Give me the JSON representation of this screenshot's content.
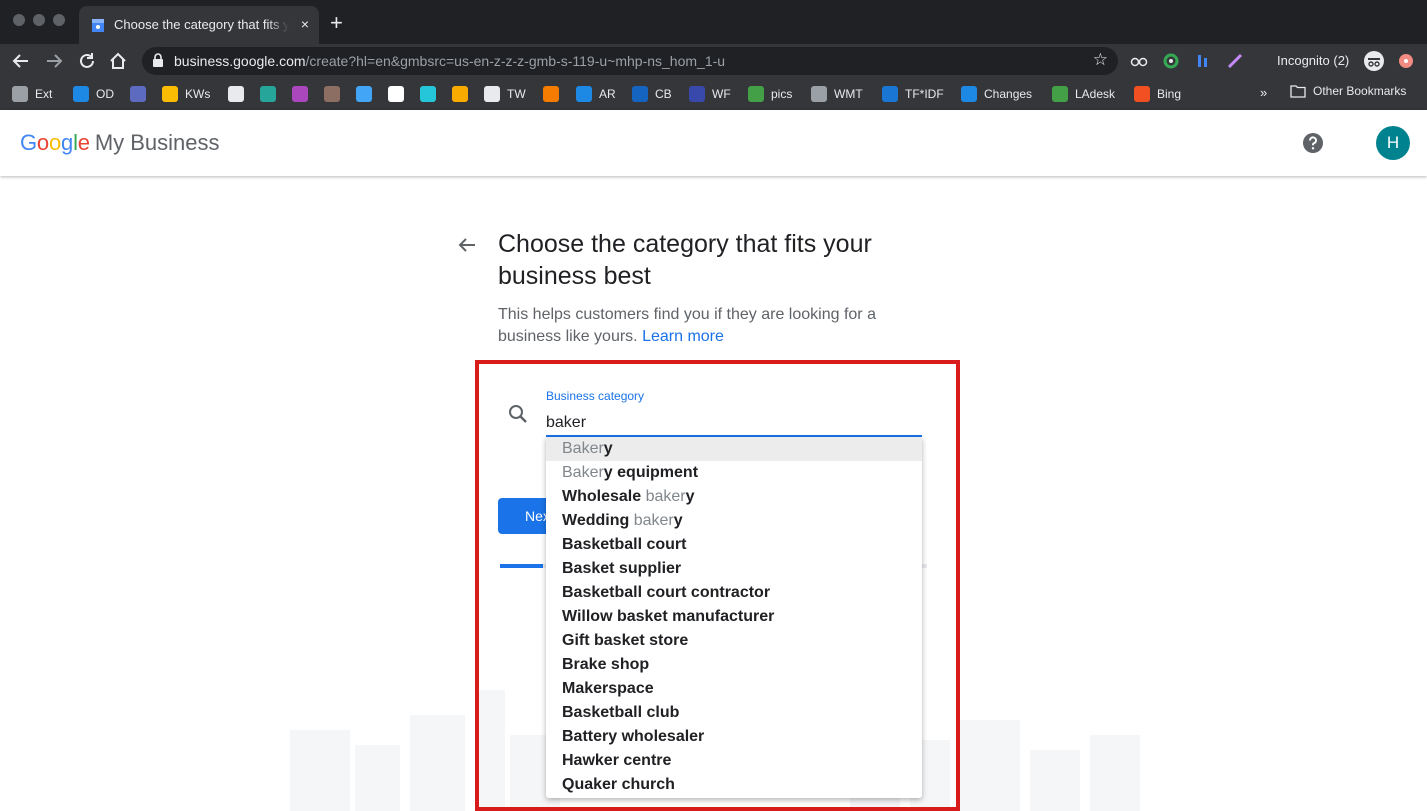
{
  "browser": {
    "tab_title": "Choose the category that fits your business best",
    "tab_close": "×",
    "new_tab": "+",
    "url_domain": "business.google.com",
    "url_path": "/create?hl=en&gmbsrc=us-en-z-z-z-gmb-s-119-u~mhp-ns_hom_1-u",
    "star": "☆",
    "incognito_label": "Incognito (2)",
    "menu": "⋮"
  },
  "bookmarks": {
    "items": [
      {
        "label": "Ext",
        "color": "#9aa0a6"
      },
      {
        "label": "OD",
        "color": "#1e88e5"
      },
      {
        "label": "",
        "color": "#5c6bc0"
      },
      {
        "label": "KWs",
        "color": "#fbbc04"
      },
      {
        "label": "",
        "color": "#e8eaed"
      },
      {
        "label": "",
        "color": "#26a69a"
      },
      {
        "label": "",
        "color": "#ab47bc"
      },
      {
        "label": "",
        "color": "#8d6e63"
      },
      {
        "label": "",
        "color": "#42a5f5"
      },
      {
        "label": "",
        "color": "#ffffff"
      },
      {
        "label": "",
        "color": "#26c6da"
      },
      {
        "label": "",
        "color": "#f9ab00"
      },
      {
        "label": "TW",
        "color": "#e8eaed"
      },
      {
        "label": "",
        "color": "#f57c00"
      },
      {
        "label": "AR",
        "color": "#1e88e5"
      },
      {
        "label": "CB",
        "color": "#1565c0"
      },
      {
        "label": "WF",
        "color": "#3949ab"
      },
      {
        "label": "pics",
        "color": "#43a047"
      },
      {
        "label": "WMT",
        "color": "#9aa0a6"
      },
      {
        "label": "TF*IDF",
        "color": "#1976d2"
      },
      {
        "label": "Changes",
        "color": "#1e88e5"
      },
      {
        "label": "LAdesk",
        "color": "#43a047"
      },
      {
        "label": "Bing",
        "color": "#f25022"
      }
    ],
    "more": "»",
    "other_label": "Other Bookmarks"
  },
  "header": {
    "logo_letters": [
      {
        "ch": "G",
        "color": "#4285f4"
      },
      {
        "ch": "o",
        "color": "#ea4335"
      },
      {
        "ch": "o",
        "color": "#fbbc05"
      },
      {
        "ch": "g",
        "color": "#4285f4"
      },
      {
        "ch": "l",
        "color": "#34a853"
      },
      {
        "ch": "e",
        "color": "#ea4335"
      }
    ],
    "product": "My Business",
    "avatar_initial": "H"
  },
  "main": {
    "title": "Choose the category that fits your business best",
    "subtitle": "This helps customers find you if they are looking for a business like yours.",
    "learn_more": "Learn more",
    "field_label": "Business category",
    "field_value": "baker",
    "next_label": "Next",
    "progress_fraction": 0.1
  },
  "suggestions": [
    {
      "parts": [
        {
          "t": "Baker",
          "m": true
        },
        {
          "t": "y",
          "m": false
        }
      ],
      "active": true
    },
    {
      "parts": [
        {
          "t": "Baker",
          "m": true
        },
        {
          "t": "y equipment",
          "m": false
        }
      ]
    },
    {
      "parts": [
        {
          "t": "Wholesale ",
          "m": false
        },
        {
          "t": "baker",
          "m": true
        },
        {
          "t": "y",
          "m": false
        }
      ]
    },
    {
      "parts": [
        {
          "t": "Wedding ",
          "m": false
        },
        {
          "t": "baker",
          "m": true
        },
        {
          "t": "y",
          "m": false
        }
      ]
    },
    {
      "parts": [
        {
          "t": "Basketball court",
          "m": false
        }
      ]
    },
    {
      "parts": [
        {
          "t": "Basket supplier",
          "m": false
        }
      ]
    },
    {
      "parts": [
        {
          "t": "Basketball court contractor",
          "m": false
        }
      ]
    },
    {
      "parts": [
        {
          "t": "Willow basket manufacturer",
          "m": false
        }
      ]
    },
    {
      "parts": [
        {
          "t": "Gift basket store",
          "m": false
        }
      ]
    },
    {
      "parts": [
        {
          "t": "Brake shop",
          "m": false
        }
      ]
    },
    {
      "parts": [
        {
          "t": "Makerspace",
          "m": false
        }
      ]
    },
    {
      "parts": [
        {
          "t": "Basketball club",
          "m": false
        }
      ]
    },
    {
      "parts": [
        {
          "t": "Battery wholesaler",
          "m": false
        }
      ]
    },
    {
      "parts": [
        {
          "t": "Hawker centre",
          "m": false
        }
      ]
    },
    {
      "parts": [
        {
          "t": "Quaker church",
          "m": false
        }
      ]
    }
  ]
}
